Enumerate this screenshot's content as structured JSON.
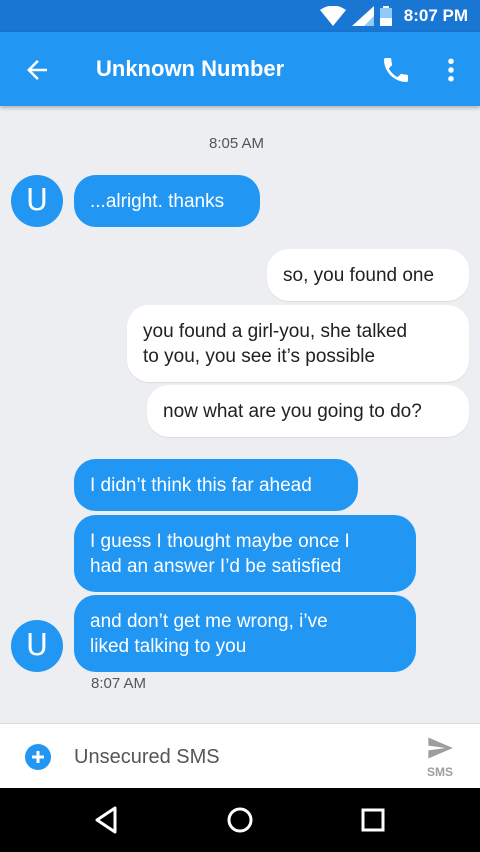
{
  "status_bar": {
    "time": "8:07 PM"
  },
  "app_bar": {
    "title": "Unknown Number"
  },
  "conversation": {
    "timestamp_top": "8:05 AM",
    "avatar_letter": "U",
    "messages": [
      {
        "direction": "incoming",
        "text": "...alright. thanks"
      },
      {
        "direction": "outgoing",
        "text": "so, you found one"
      },
      {
        "direction": "outgoing",
        "lines": [
          "you found a girl-you, she talked",
          "to you, you see it’s possible"
        ]
      },
      {
        "direction": "outgoing",
        "text": "now what are you going to do?"
      },
      {
        "direction": "incoming",
        "text": "I didn’t think this far ahead"
      },
      {
        "direction": "incoming",
        "lines": [
          "I guess I thought maybe once I",
          "had an answer I’d be satisfied"
        ]
      },
      {
        "direction": "incoming",
        "lines": [
          "and don’t get me wrong, i’ve",
          "liked talking to you"
        ]
      }
    ],
    "timestamp_bottom": "8:07 AM"
  },
  "composer": {
    "placeholder": "Unsecured SMS",
    "send_label": "SMS"
  },
  "colors": {
    "primary": "#2196f3",
    "primary_dark": "#1976d2",
    "background": "#eceef1"
  },
  "icons": [
    "wifi-icon",
    "signal-icon",
    "battery-icon",
    "back-arrow-icon",
    "phone-icon",
    "more-vert-icon",
    "add-circle-icon",
    "send-icon",
    "nav-back-icon",
    "nav-home-icon",
    "nav-recents-icon"
  ]
}
